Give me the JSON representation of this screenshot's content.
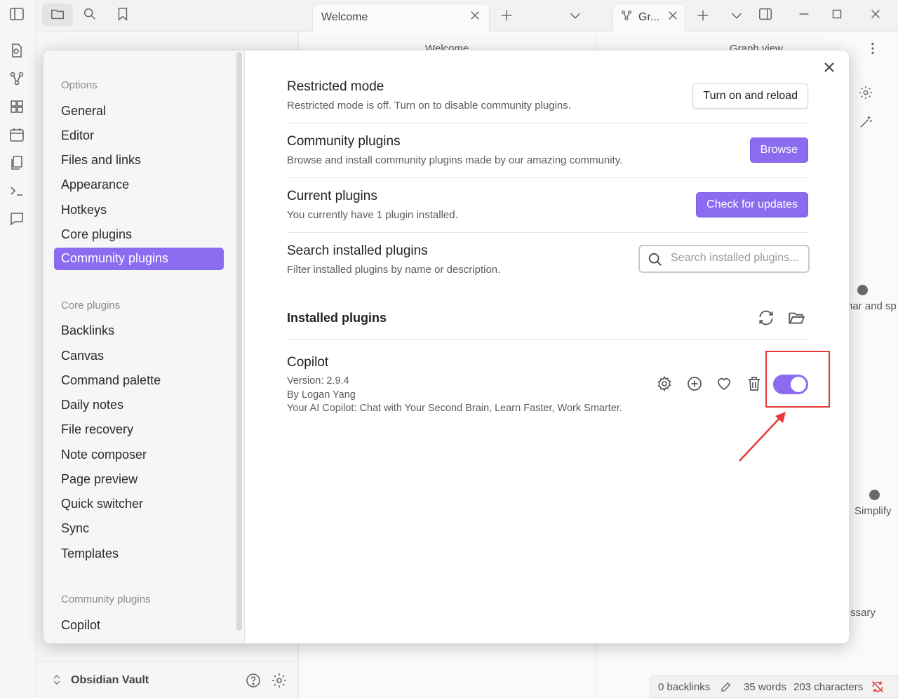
{
  "tabs": {
    "welcome_tab": "Welcome",
    "graph_tab": "Gr...",
    "welcome_header": "Welcome",
    "graph_header": "Graph view"
  },
  "background": {
    "graph_label_1": "nar and sp",
    "graph_label_2": "Simplify",
    "graph_label_3": "ssary"
  },
  "vault": {
    "name": "Obsidian Vault"
  },
  "statusbar": {
    "backlinks": "0 backlinks",
    "words": "35 words",
    "characters": "203 characters"
  },
  "settings_sidebar": {
    "options_heading": "Options",
    "options": [
      "General",
      "Editor",
      "Files and links",
      "Appearance",
      "Hotkeys",
      "Core plugins",
      "Community plugins"
    ],
    "core_heading": "Core plugins",
    "core": [
      "Backlinks",
      "Canvas",
      "Command palette",
      "Daily notes",
      "File recovery",
      "Note composer",
      "Page preview",
      "Quick switcher",
      "Sync",
      "Templates"
    ],
    "community_heading": "Community plugins",
    "community": [
      "Copilot"
    ]
  },
  "community_page": {
    "restricted": {
      "name": "Restricted mode",
      "desc": "Restricted mode is off. Turn on to disable community plugins.",
      "button": "Turn on and reload"
    },
    "community": {
      "name": "Community plugins",
      "desc": "Browse and install community plugins made by our amazing community.",
      "button": "Browse"
    },
    "current": {
      "name": "Current plugins",
      "desc": "You currently have 1 plugin installed.",
      "button": "Check for updates"
    },
    "search": {
      "name": "Search installed plugins",
      "desc": "Filter installed plugins by name or description.",
      "placeholder": "Search installed plugins..."
    },
    "installed_heading": "Installed plugins",
    "plugin": {
      "name": "Copilot",
      "version": "Version: 2.9.4",
      "author": "By Logan Yang",
      "description": "Your AI Copilot: Chat with Your Second Brain, Learn Faster, Work Smarter.",
      "enabled": true
    }
  },
  "colors": {
    "accent": "#8b6cf0",
    "highlight": "#e53935"
  }
}
